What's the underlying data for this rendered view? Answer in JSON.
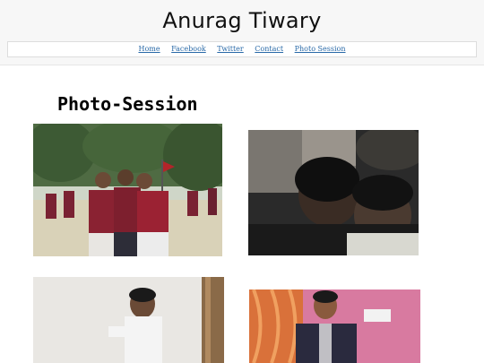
{
  "site": {
    "title": "Anurag Tiwary"
  },
  "nav": {
    "home": "Home",
    "facebook": "Facebook",
    "twitter": "Twitter",
    "contact": "Contact",
    "photo_session": "Photo Session"
  },
  "page": {
    "heading": "Photo-Session"
  },
  "photos": [
    {
      "name": "group-photo",
      "desc": "students in uniform outdoors"
    },
    {
      "name": "selfie-photo",
      "desc": "two boys selfie dark tone"
    },
    {
      "name": "boy-white-shirt-photo",
      "desc": "boy in white shirt indoors"
    },
    {
      "name": "man-blazer-photo",
      "desc": "man in blazer pink background"
    }
  ]
}
